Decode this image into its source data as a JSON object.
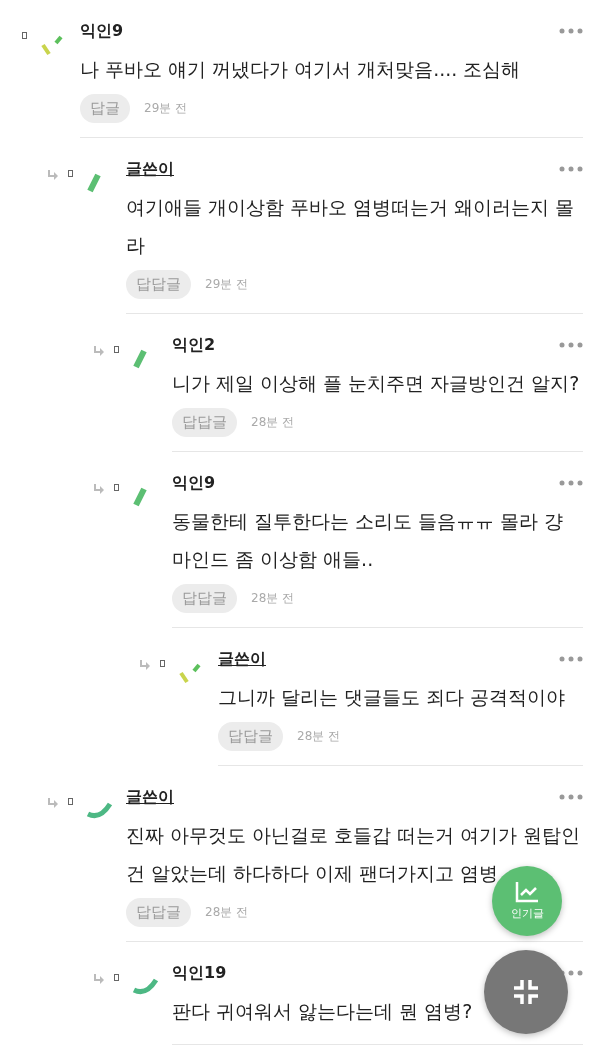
{
  "comments": [
    {
      "author": "익인9",
      "is_writer": false,
      "kind": "ticks",
      "text": "나 푸바오 얘기 꺼냈다가 여기서 개처맞음.... 조심해",
      "reply_label": "답글",
      "time": "29분 전",
      "children": [
        {
          "author": "글쓴이",
          "is_writer": true,
          "kind": "bar",
          "text": "여기애들 개이상함 푸바오 염병떠는거 왜이러는지 몰라",
          "reply_label": "답답글",
          "time": "29분 전",
          "children": [
            {
              "author": "익인2",
              "is_writer": false,
              "kind": "bar",
              "text": "니가 제일 이상해 플 눈치주면 자글방인건 알지?",
              "reply_label": "답답글",
              "time": "28분 전"
            },
            {
              "author": "익인9",
              "is_writer": false,
              "kind": "bar",
              "text": "동물한테 질투한다는 소리도 들음ㅠㅠ 몰라 걍 마인드 좀 이상함 애들..",
              "reply_label": "답답글",
              "time": "28분 전",
              "children": [
                {
                  "author": "글쓴이",
                  "is_writer": true,
                  "kind": "ticks",
                  "text": "그니까 달리는 댓글들도 죄다 공격적이야",
                  "reply_label": "답답글",
                  "time": "28분 전"
                }
              ]
            }
          ]
        },
        {
          "author": "글쓴이",
          "is_writer": true,
          "kind": "arc",
          "text": "진짜 아무것도 아닌걸로 호들갑 떠는거 여기가 원탑인건 알았는데 하다하다 이제 팬더가지고 염병",
          "reply_label": "답답글",
          "time": "28분 전",
          "children": [
            {
              "author": "익인19",
              "is_writer": false,
              "kind": "arc",
              "text": "판다 귀여워서 앓는다는데 뭔 염병?"
            }
          ]
        }
      ]
    }
  ],
  "popular_button": {
    "label": "인기글"
  }
}
